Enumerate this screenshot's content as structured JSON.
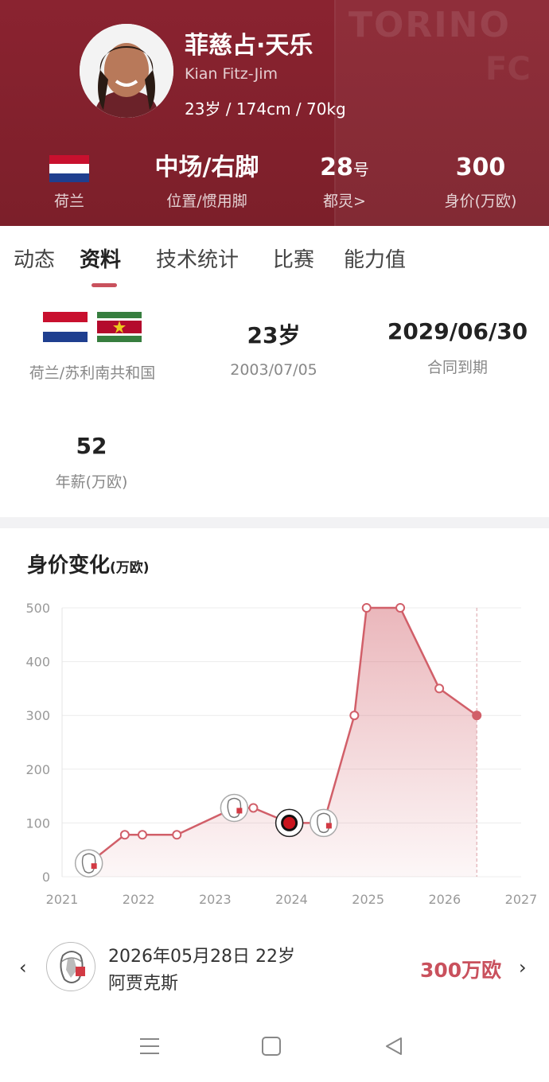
{
  "header": {
    "bg_logo_text": "TORINO",
    "bg_logo_text2": "FC",
    "name_cn": "菲慈占·天乐",
    "name_en": "Kian Fitz-Jim",
    "bio": "23岁 / 174cm / 70kg",
    "stats": {
      "nation_label": "荷兰",
      "position_value": "中场/右脚",
      "position_label": "位置/惯用脚",
      "number_value": "28",
      "number_suffix": "号",
      "club_label": "都灵>",
      "value_value": "300",
      "value_label": "身价(万欧)"
    }
  },
  "tabs": [
    "动态",
    "资料",
    "技术统计",
    "比赛",
    "能力值"
  ],
  "active_tab_index": 1,
  "profile": {
    "nationality": "荷兰/苏利南共和国",
    "age": "23岁",
    "birthdate": "2003/07/05",
    "contract_end": "2029/06/30",
    "contract_label": "合同到期",
    "salary": "52",
    "salary_label": "年薪(万欧)"
  },
  "chart_section": {
    "title": "身价变化",
    "unit": "(万欧)"
  },
  "chart_data": {
    "type": "area",
    "x_ticks": [
      "2021",
      "2022",
      "2023",
      "2024",
      "2025",
      "2026",
      "2027"
    ],
    "y_ticks": [
      "0",
      "100",
      "200",
      "300",
      "400",
      "500"
    ],
    "xlim": [
      2021.0,
      2027.0
    ],
    "ylim": [
      0,
      500
    ],
    "grid": true,
    "color": "#d15f69",
    "points": [
      {
        "x": 2021.35,
        "y": 25,
        "marker": "ajax"
      },
      {
        "x": 2021.82,
        "y": 78,
        "marker": "dot"
      },
      {
        "x": 2022.05,
        "y": 78,
        "marker": "dot"
      },
      {
        "x": 2022.5,
        "y": 78,
        "marker": "dot"
      },
      {
        "x": 2023.25,
        "y": 128,
        "marker": "ajax"
      },
      {
        "x": 2023.5,
        "y": 128,
        "marker": "dot"
      },
      {
        "x": 2023.97,
        "y": 100,
        "marker": "excelsior"
      },
      {
        "x": 2024.42,
        "y": 100,
        "marker": "ajax"
      },
      {
        "x": 2024.82,
        "y": 300,
        "marker": "dot"
      },
      {
        "x": 2024.98,
        "y": 500,
        "marker": "dot"
      },
      {
        "x": 2025.42,
        "y": 500,
        "marker": "dot"
      },
      {
        "x": 2025.93,
        "y": 350,
        "marker": "dot"
      },
      {
        "x": 2026.42,
        "y": 300,
        "marker": "current"
      }
    ],
    "current_x": 2026.42
  },
  "record": {
    "date_age": "2026年05月28日 22岁",
    "club": "阿贾克斯",
    "value": "300万欧",
    "prev_icon": "chevron-left-icon",
    "next_icon": "chevron-right-icon"
  },
  "colors": {
    "header_bg": "#7c1f2a",
    "accent": "#c9515d"
  }
}
